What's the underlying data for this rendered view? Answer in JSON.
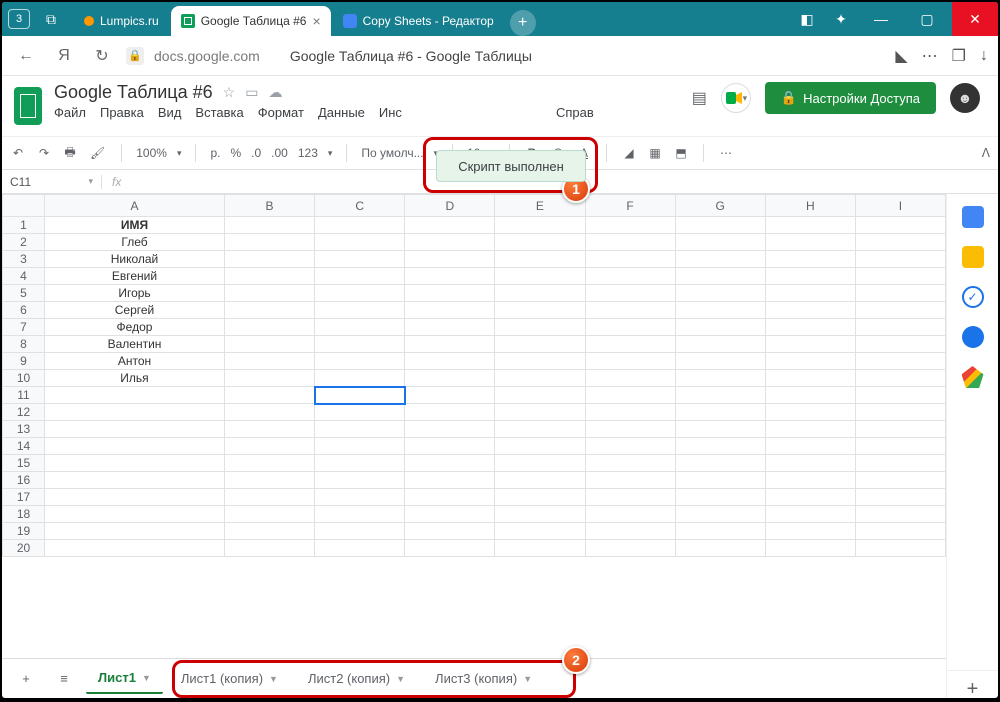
{
  "titlebar": {
    "home_num": "3",
    "tabs": {
      "lumpics": "Lumpics.ru",
      "sheets": "Google Таблица #6",
      "copy": "Copy Sheets - Редактор"
    }
  },
  "addressbar": {
    "domain": "docs.google.com",
    "page_title": "Google Таблица #6 - Google Таблицы"
  },
  "doc": {
    "title": "Google Таблица #6",
    "menus": [
      "Файл",
      "Правка",
      "Вид",
      "Вставка",
      "Формат",
      "Данные",
      "Инс",
      "Справ"
    ],
    "share_label": "Настройки Доступа"
  },
  "toolbar": {
    "zoom": "100%",
    "currency": "р.",
    "percent": "%",
    "dec0": ".0",
    "dec00": ".00",
    "num123": "123",
    "font": "По умолч...",
    "size": "10"
  },
  "fxbar": {
    "cell": "C11",
    "fx": "fx"
  },
  "grid": {
    "columns": [
      "A",
      "B",
      "C",
      "D",
      "E",
      "F",
      "G",
      "H",
      "I"
    ],
    "rows": [
      {
        "n": 1,
        "A": "ИМЯ"
      },
      {
        "n": 2,
        "A": "Глеб"
      },
      {
        "n": 3,
        "A": "Николай"
      },
      {
        "n": 4,
        "A": "Евгений"
      },
      {
        "n": 5,
        "A": "Игорь"
      },
      {
        "n": 6,
        "A": "Сергей"
      },
      {
        "n": 7,
        "A": "Федор"
      },
      {
        "n": 8,
        "A": "Валентин"
      },
      {
        "n": 9,
        "A": "Антон"
      },
      {
        "n": 10,
        "A": "Илья"
      },
      {
        "n": 11,
        "A": ""
      },
      {
        "n": 12,
        "A": ""
      },
      {
        "n": 13,
        "A": ""
      },
      {
        "n": 14,
        "A": ""
      },
      {
        "n": 15,
        "A": ""
      },
      {
        "n": 16,
        "A": ""
      },
      {
        "n": 17,
        "A": ""
      },
      {
        "n": 18,
        "A": ""
      },
      {
        "n": 19,
        "A": ""
      },
      {
        "n": 20,
        "A": ""
      }
    ]
  },
  "toast_text": "Скрипт выполнен",
  "sheets": {
    "active": "Лист1",
    "copies": [
      "Лист1 (копия)",
      "Лист2 (копия)",
      "Лист3 (копия)"
    ]
  },
  "badges": {
    "one": "1",
    "two": "2"
  }
}
